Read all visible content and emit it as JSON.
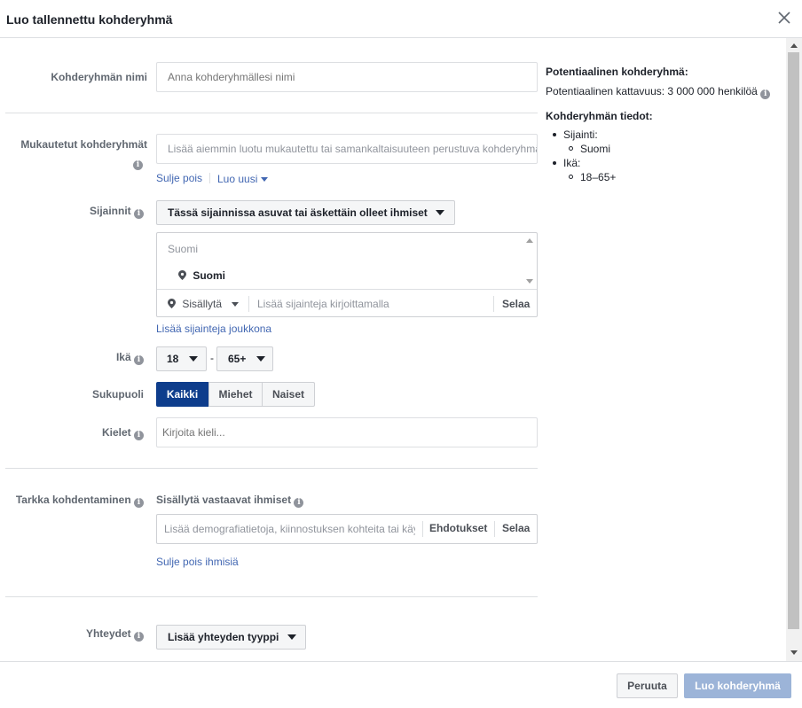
{
  "dialog": {
    "title": "Luo tallennettu kohderyhmä"
  },
  "form": {
    "name": {
      "label": "Kohderyhmän nimi",
      "placeholder": "Anna kohderyhmällesi nimi"
    },
    "custom_audiences": {
      "label": "Mukautetut kohderyhmät",
      "placeholder": "Lisää aiemmin luotu mukautettu tai samankaltaisuuteen perustuva kohderyhmä",
      "exclude_link": "Sulje pois",
      "create_new_link": "Luo uusi"
    },
    "locations": {
      "label": "Sijainnit",
      "type_dropdown": "Tässä sijainnissa asuvat tai äskettäin olleet ihmiset",
      "group_header": "Suomi",
      "selected_item": "Suomi",
      "include_dropdown": "Sisällytä",
      "search_placeholder": "Lisää sijainteja kirjoittamalla",
      "browse_button": "Selaa",
      "bulk_link": "Lisää sijainteja joukkona"
    },
    "age": {
      "label": "Ikä",
      "min": "18",
      "separator": "-",
      "max": "65+"
    },
    "gender": {
      "label": "Sukupuoli",
      "options": [
        "Kaikki",
        "Miehet",
        "Naiset"
      ],
      "selected": "Kaikki"
    },
    "languages": {
      "label": "Kielet",
      "placeholder": "Kirjoita kieli..."
    },
    "detailed_targeting": {
      "label": "Tarkka kohdentaminen",
      "include_label": "Sisällytä vastaavat ihmiset",
      "placeholder": "Lisää demografiatietoja, kiinnostuksen kohteita tai käyttäytymistä",
      "suggestions_button": "Ehdotukset",
      "browse_button": "Selaa",
      "exclude_link": "Sulje pois ihmisiä"
    },
    "connections": {
      "label": "Yhteydet",
      "dropdown": "Lisää yhteyden tyyppi"
    }
  },
  "summary": {
    "potential_title": "Potentiaalinen kohderyhmä:",
    "potential_reach": "Potentiaalinen kattavuus: 3 000 000 henkilöä",
    "details_title": "Kohderyhmän tiedot:",
    "location_label": "Sijainti:",
    "location_value": "Suomi",
    "age_label": "Ikä:",
    "age_value": "18–65+"
  },
  "footer": {
    "cancel": "Peruuta",
    "create": "Luo kohderyhmä"
  },
  "colors": {
    "accent": "#4267b2",
    "selected_segment": "#0e3d8c",
    "disabled_primary": "#9cb4d8"
  }
}
